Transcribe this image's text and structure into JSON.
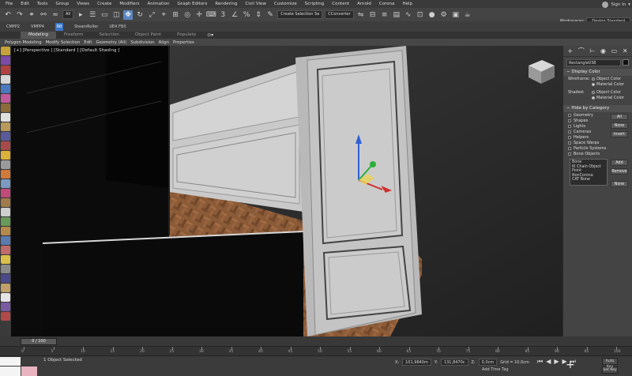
{
  "menu": {
    "items": [
      "File",
      "Edit",
      "Tools",
      "Group",
      "Views",
      "Create",
      "Modifiers",
      "Animation",
      "Graph Editors",
      "Rendering",
      "Civil View",
      "Customize",
      "Scripting",
      "Content",
      "Arnold",
      "Corona",
      "Help"
    ],
    "sign_in": "Sign In"
  },
  "toolbar": {
    "selection_filter": "All",
    "selection_set": "Create Selection Se",
    "converter": "CConverter",
    "workspaces_label": "Workspaces:",
    "workspace_value": "Design Standard"
  },
  "shelf": {
    "items": [
      "CMPP2",
      "VMPP4",
      "SteamRoller",
      "UE4 FBX"
    ],
    "rb_label": "RB"
  },
  "ribbon": {
    "tabs": [
      "Modeling",
      "Freeform",
      "Selection",
      "Object Paint",
      "Populate"
    ],
    "active_tab": "Modeling",
    "sub_items": [
      "Polygon Modeling",
      "Modify Selection",
      "Edit",
      "Geometry (All)",
      "Subdivision",
      "Align",
      "Properties"
    ]
  },
  "viewport": {
    "label": "[+] [Perspective ] [Standard ] [Default Shading ]"
  },
  "command_panel": {
    "object_name": "Rectangle038",
    "display_color": {
      "title": "Display Color",
      "wireframe_label": "Wireframe:",
      "shaded_label": "Shaded:",
      "object_color": "Object Color",
      "material_color": "Material Color"
    },
    "hide_by_category": {
      "title": "Hide by Category",
      "categories": [
        "Geometry",
        "Shapes",
        "Lights",
        "Cameras",
        "Helpers",
        "Space Warps",
        "Particle Systems",
        "Bone Objects"
      ],
      "buttons": [
        "All",
        "None",
        "Invert"
      ],
      "list_items": [
        "Bone",
        "IK Chain Object",
        "Point",
        "NonCorona",
        "CAT Bone"
      ],
      "list_buttons": [
        "Add",
        "Remove",
        "None"
      ]
    }
  },
  "timeline": {
    "slider": "0 / 100",
    "ticks": [
      "0",
      "5",
      "10",
      "15",
      "20",
      "25",
      "30",
      "35",
      "40",
      "45",
      "50",
      "55",
      "60",
      "65",
      "70",
      "75",
      "80",
      "85",
      "90",
      "95",
      "100"
    ]
  },
  "status": {
    "selected": "1 Object Selected",
    "x_label": "X:",
    "x_value": "101,9840m",
    "y_label": "Y:",
    "y_value": "131,8470c",
    "z_label": "Z:",
    "z_value": "0,0cm",
    "grid": "Grid = 10,0cm",
    "add_time_tag": "Add Time Tag",
    "auto_key": "Auto Key",
    "set_key": "Set Key"
  },
  "colors": {
    "accent": "#5b86c2",
    "wall": "#c9c9c9",
    "floor": "#8a5a3a",
    "gizmo_x": "#d03030",
    "gizmo_y": "#2fae3b",
    "gizmo_z": "#2f5fd8"
  }
}
